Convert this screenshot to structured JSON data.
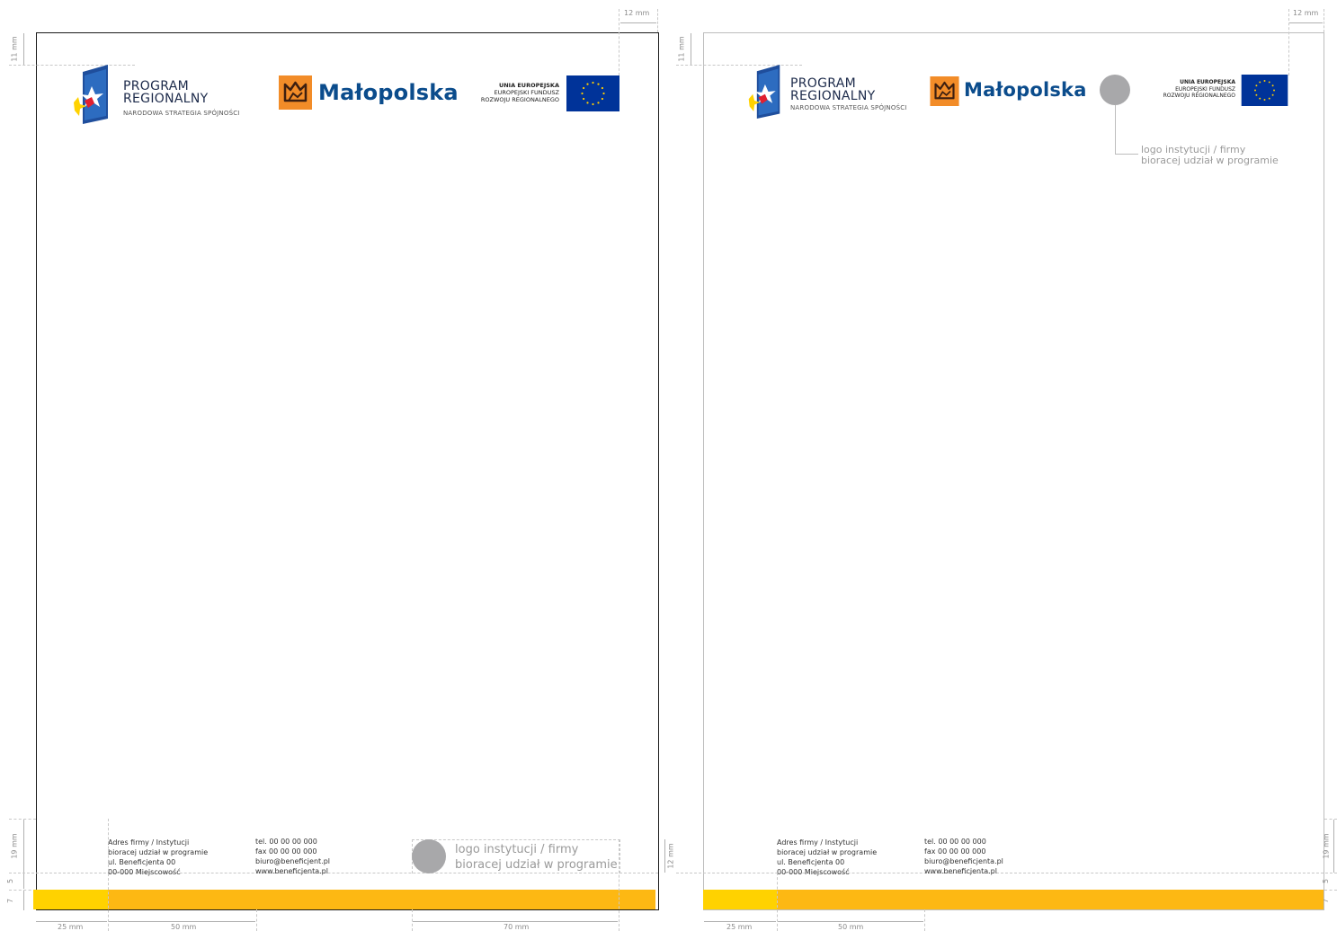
{
  "dimensions": {
    "top_right": "12 mm",
    "top_left": "11 mm",
    "footer_height": "19 mm",
    "bottom_a": "7",
    "bottom_b": "5",
    "logo_box_height": "12 mm",
    "left_margin": "25 mm",
    "address_width": "50 mm",
    "logo_box_width": "70 mm"
  },
  "header": {
    "program_line1": "PROGRAM",
    "program_line2": "REGIONALNY",
    "program_sub": "NARODOWA STRATEGIA SPÓJNOŚCI",
    "malopolska": "Małopolska",
    "ue_line1": "UNIA EUROPEJSKA",
    "ue_line2": "EUROPEJSKI FUNDUSZ",
    "ue_line3": "ROZWOJU REGIONALNEGO"
  },
  "footer": {
    "address": [
      "Adres firmy / Instytucji",
      "bioracej udział w programie",
      "ul. Beneficjenta 00",
      "00-000 Miejscowość"
    ],
    "contact_left": [
      "tel. 00 00 00 000",
      "fax  00 00 00 000",
      "biuro@beneficjent.pl",
      "www.beneficjenta.pl"
    ],
    "contact_right": [
      "tel. 00 00 00 000",
      "fax  00 00 00 000",
      "biuro@beneficjenta.pl",
      "www.beneficjenta.pl"
    ],
    "logo_note_line1": "logo instytucji / firmy",
    "logo_note_line2": "bioracej udział w programie"
  },
  "header_logo_note": {
    "line1": "logo instytucji / firmy",
    "line2": "bioracej udział w programie"
  },
  "colors": {
    "bar_yellow": "#ffd200",
    "bar_orange": "#fdb813",
    "eu_blue": "#003399",
    "malopolska_orange": "#f28c28",
    "malopolska_blue": "#0b4c8c"
  }
}
